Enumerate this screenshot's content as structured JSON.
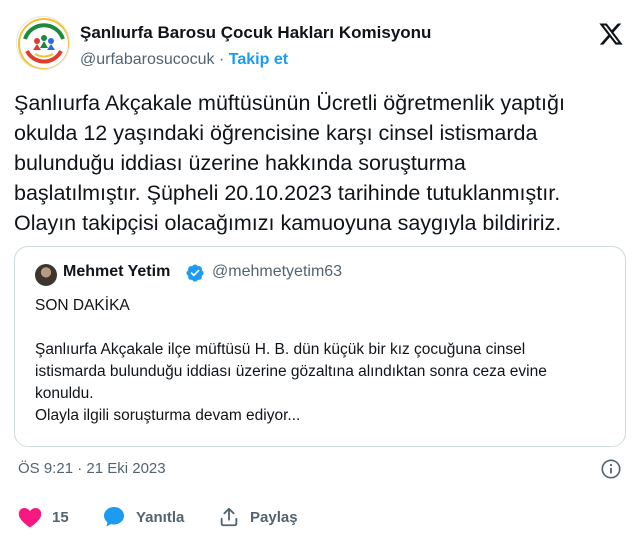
{
  "author": {
    "display_name": "Şanlıurfa Barosu Çocuk Hakları Komisyonu",
    "handle": "@urfabarosucocuk",
    "separator": "·",
    "follow_label": "Takip et"
  },
  "tweet": {
    "text_lines": [
      "Şanlıurfa Akçakale müftüsünün Ücretli öğretmenlik yaptığı",
      "okulda 12 yaşındaki öğrencisine karşı cinsel istismarda",
      "bulunduğu iddiası üzerine hakkında soruşturma",
      "başlatılmıştır. Şüpheli 20.10.2023 tarihinde tutuklanmıştır.",
      "Olayın takipçisi olacağımızı kamuoyuna saygıyla bildiririz."
    ]
  },
  "quoted_tweet": {
    "display_name": "Mehmet Yetim",
    "handle": "@mehmetyetim63",
    "lines": [
      "SON DAKİKA",
      "",
      "Şanlıurfa Akçakale ilçe müftüsü H. B. dün küçük bir kız çocuğuna cinsel",
      "istismarda bulunduğu iddiası üzerine gözaltına alındıktan sonra ceza evine",
      "konuldu.",
      "Olayla ilgili soruşturma devam ediyor..."
    ]
  },
  "timestamp": "ÖS 9:21 · 21 Eki 2023",
  "actions": {
    "like_count": "15",
    "reply_label": "Yanıtla",
    "share_label": "Paylaş"
  },
  "icons": {
    "brand_logo": "x-logo-icon",
    "info": "info-icon",
    "like": "heart-icon",
    "reply": "speech-bubble-icon",
    "share": "share-upload-icon",
    "verified": "verified-badge-icon"
  },
  "colors": {
    "accent": "#1d9bf0",
    "text": "#0f1419",
    "secondary_text": "#536471",
    "like": "#f91880",
    "border": "#cfd9de"
  }
}
